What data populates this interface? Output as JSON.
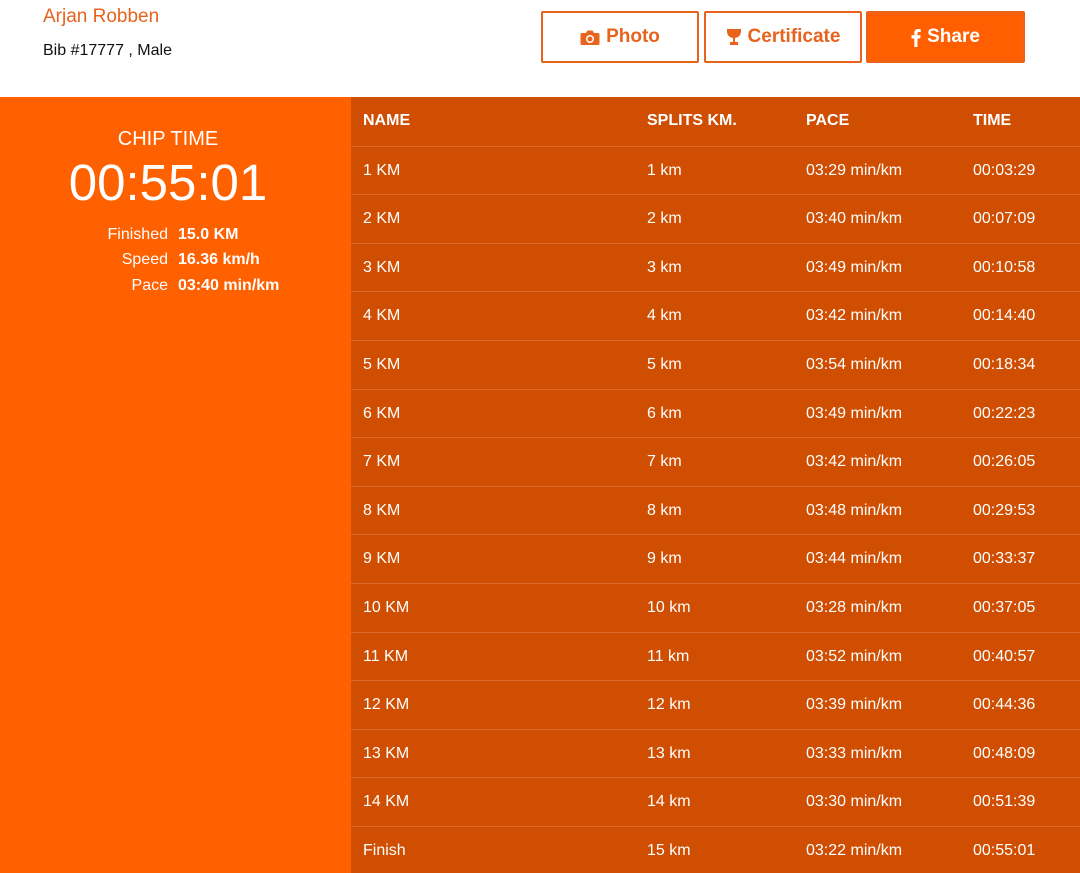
{
  "athlete": {
    "name": "Arjan Robben",
    "meta": "Bib #17777 , Male"
  },
  "buttons": {
    "photo": "Photo",
    "certificate": "Certificate",
    "share": "Share"
  },
  "summary": {
    "chip_label": "CHIP TIME",
    "chip_time": "00:55:01",
    "stats": [
      {
        "label": "Finished",
        "value": "15.0 KM"
      },
      {
        "label": "Speed",
        "value": "16.36 km/h"
      },
      {
        "label": "Pace",
        "value": "03:40 min/km"
      }
    ]
  },
  "table": {
    "columns": [
      "NAME",
      "SPLITS KM.",
      "PACE",
      "TIME"
    ],
    "rows": [
      [
        "1 KM",
        "1 km",
        "03:29 min/km",
        "00:03:29"
      ],
      [
        "2 KM",
        "2 km",
        "03:40 min/km",
        "00:07:09"
      ],
      [
        "3 KM",
        "3 km",
        "03:49 min/km",
        "00:10:58"
      ],
      [
        "4 KM",
        "4 km",
        "03:42 min/km",
        "00:14:40"
      ],
      [
        "5 KM",
        "5 km",
        "03:54 min/km",
        "00:18:34"
      ],
      [
        "6 KM",
        "6 km",
        "03:49 min/km",
        "00:22:23"
      ],
      [
        "7 KM",
        "7 km",
        "03:42 min/km",
        "00:26:05"
      ],
      [
        "8 KM",
        "8 km",
        "03:48 min/km",
        "00:29:53"
      ],
      [
        "9 KM",
        "9 km",
        "03:44 min/km",
        "00:33:37"
      ],
      [
        "10 KM",
        "10 km",
        "03:28 min/km",
        "00:37:05"
      ],
      [
        "11 KM",
        "11 km",
        "03:52 min/km",
        "00:40:57"
      ],
      [
        "12 KM",
        "12 km",
        "03:39 min/km",
        "00:44:36"
      ],
      [
        "13 KM",
        "13 km",
        "03:33 min/km",
        "00:48:09"
      ],
      [
        "14 KM",
        "14 km",
        "03:30 min/km",
        "00:51:39"
      ],
      [
        "Finish",
        "15 km",
        "03:22 min/km",
        "00:55:01"
      ]
    ]
  },
  "colors": {
    "accent": "#ff6000",
    "table_bg": "#cf4e02",
    "name_text": "#e8631c"
  },
  "icons": {
    "photo": "camera-icon",
    "certificate": "trophy-icon",
    "share": "facebook-icon"
  }
}
